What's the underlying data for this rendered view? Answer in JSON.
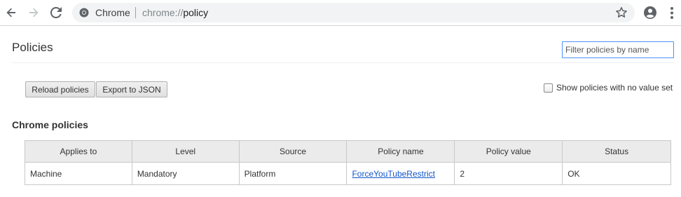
{
  "browser": {
    "site_label": "Chrome",
    "url_scheme": "chrome://",
    "url_host": "policy",
    "icons": {
      "back": "arrow-back-icon",
      "forward": "arrow-forward-icon",
      "reload": "reload-icon",
      "site": "chrome-logo-icon",
      "bookmark": "star-icon",
      "profile": "account-circle-icon",
      "menu": "more-vert-icon"
    }
  },
  "page": {
    "title": "Policies",
    "filter_placeholder": "Filter policies by name",
    "reload_label": "Reload policies",
    "export_label": "Export to JSON",
    "show_unset_label": "Show policies with no value set",
    "show_unset_checked": false,
    "section_title": "Chrome policies"
  },
  "table": {
    "headers": [
      "Applies to",
      "Level",
      "Source",
      "Policy name",
      "Policy value",
      "Status"
    ],
    "rows": [
      {
        "applies_to": "Machine",
        "level": "Mandatory",
        "source": "Platform",
        "policy_name": "ForceYouTubeRestrict",
        "policy_value": "2",
        "status": "OK"
      }
    ]
  },
  "colors": {
    "link": "#1155cc",
    "focus_border": "#4d90fe",
    "header_bg": "#ebebeb"
  }
}
